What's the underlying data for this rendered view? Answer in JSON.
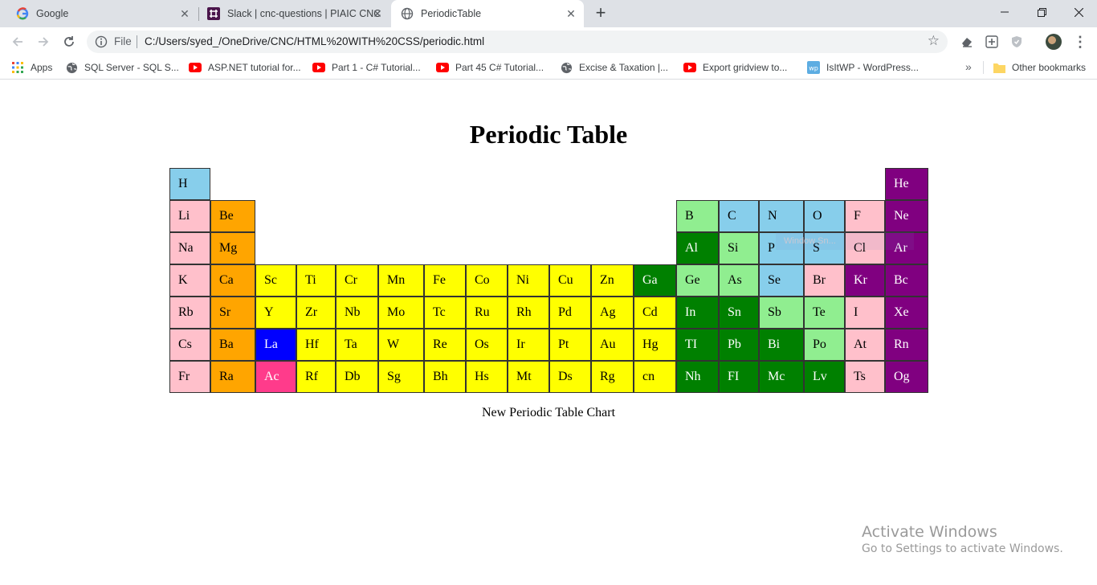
{
  "browser": {
    "tabs": [
      {
        "title": "Google",
        "icon": "google-g-icon"
      },
      {
        "title": "Slack | cnc-questions | PIAIC CNC",
        "icon": "slack-icon"
      },
      {
        "title": "PeriodicTable",
        "icon": "globe-icon"
      }
    ],
    "active_tab": 2,
    "omnibox": {
      "scheme": "File",
      "url": "C:/Users/syed_/OneDrive/CNC/HTML%20WITH%20CSS/periodic.html"
    },
    "bookmarks": [
      {
        "label": "Apps",
        "icon": "apps-grid-icon"
      },
      {
        "label": "SQL Server - SQL S...",
        "icon": "globe-icon"
      },
      {
        "label": "ASP.NET tutorial for...",
        "icon": "youtube-icon"
      },
      {
        "label": "Part 1 - C# Tutorial...",
        "icon": "youtube-icon"
      },
      {
        "label": "Part 45 C# Tutorial...",
        "icon": "youtube-icon"
      },
      {
        "label": "Excise & Taxation |...",
        "icon": "globe-icon"
      },
      {
        "label": "Export gridview to...",
        "icon": "youtube-icon"
      },
      {
        "label": "IsItWP - WordPress...",
        "icon": "wordpress-icon"
      }
    ],
    "bookmarks_more": "»",
    "other_bookmarks": "Other bookmarks"
  },
  "colors": {
    "pink": "#ffc0cb",
    "orange": "#ffa500",
    "yellow": "#ffff00",
    "green": "#008000",
    "lightgreen": "#90ee90",
    "skyblue": "#87ceeb",
    "purple": "#800080",
    "blue": "#0000ff",
    "magenta": "#ff3b8b"
  },
  "page": {
    "title": "Periodic Table",
    "caption": "New Periodic Table Chart",
    "overlay_text": "Window Sn..."
  },
  "elements": [
    {
      "symbol": "H",
      "color": "skyblue"
    },
    {
      "symbol": "He",
      "color": "purple"
    },
    {
      "symbol": "Li",
      "color": "pink"
    },
    {
      "symbol": "Be",
      "color": "orange"
    },
    {
      "symbol": "B",
      "color": "lightgreen"
    },
    {
      "symbol": "C",
      "color": "skyblue"
    },
    {
      "symbol": "N",
      "color": "skyblue"
    },
    {
      "symbol": "O",
      "color": "skyblue"
    },
    {
      "symbol": "F",
      "color": "pink"
    },
    {
      "symbol": "Ne",
      "color": "purple"
    },
    {
      "symbol": "Na",
      "color": "pink"
    },
    {
      "symbol": "Mg",
      "color": "orange"
    },
    {
      "symbol": "Al",
      "color": "green"
    },
    {
      "symbol": "Si",
      "color": "lightgreen"
    },
    {
      "symbol": "P",
      "color": "skyblue"
    },
    {
      "symbol": "S",
      "color": "skyblue"
    },
    {
      "symbol": "Cl",
      "color": "pink"
    },
    {
      "symbol": "Ar",
      "color": "purple"
    },
    {
      "symbol": "K",
      "color": "pink"
    },
    {
      "symbol": "Ca",
      "color": "orange"
    },
    {
      "symbol": "Sc",
      "color": "yellow"
    },
    {
      "symbol": "Ti",
      "color": "yellow"
    },
    {
      "symbol": "Cr",
      "color": "yellow"
    },
    {
      "symbol": "Mn",
      "color": "yellow"
    },
    {
      "symbol": "Fe",
      "color": "yellow"
    },
    {
      "symbol": "Co",
      "color": "yellow"
    },
    {
      "symbol": "Ni",
      "color": "yellow"
    },
    {
      "symbol": "Cu",
      "color": "yellow"
    },
    {
      "symbol": "Zn",
      "color": "yellow"
    },
    {
      "symbol": "Ga",
      "color": "green"
    },
    {
      "symbol": "Ge",
      "color": "lightgreen"
    },
    {
      "symbol": "As",
      "color": "lightgreen"
    },
    {
      "symbol": "Se",
      "color": "skyblue"
    },
    {
      "symbol": "Br",
      "color": "pink"
    },
    {
      "symbol": "Kr",
      "color": "purple"
    },
    {
      "symbol": "Bc",
      "color": "purple"
    },
    {
      "symbol": "Rb",
      "color": "pink"
    },
    {
      "symbol": "Sr",
      "color": "orange"
    },
    {
      "symbol": "Y",
      "color": "yellow"
    },
    {
      "symbol": "Zr",
      "color": "yellow"
    },
    {
      "symbol": "Nb",
      "color": "yellow"
    },
    {
      "symbol": "Mo",
      "color": "yellow"
    },
    {
      "symbol": "Tc",
      "color": "yellow"
    },
    {
      "symbol": "Ru",
      "color": "yellow"
    },
    {
      "symbol": "Rh",
      "color": "yellow"
    },
    {
      "symbol": "Pd",
      "color": "yellow"
    },
    {
      "symbol": "Ag",
      "color": "yellow"
    },
    {
      "symbol": "Cd",
      "color": "yellow"
    },
    {
      "symbol": "In",
      "color": "green"
    },
    {
      "symbol": "Sn",
      "color": "green"
    },
    {
      "symbol": "Sb",
      "color": "lightgreen"
    },
    {
      "symbol": "Te",
      "color": "lightgreen"
    },
    {
      "symbol": "I",
      "color": "pink"
    },
    {
      "symbol": "Xe",
      "color": "purple"
    },
    {
      "symbol": "Cs",
      "color": "pink"
    },
    {
      "symbol": "Ba",
      "color": "orange"
    },
    {
      "symbol": "La",
      "color": "blue"
    },
    {
      "symbol": "Hf",
      "color": "yellow"
    },
    {
      "symbol": "Ta",
      "color": "yellow"
    },
    {
      "symbol": "W",
      "color": "yellow"
    },
    {
      "symbol": "Re",
      "color": "yellow"
    },
    {
      "symbol": "Os",
      "color": "yellow"
    },
    {
      "symbol": "Ir",
      "color": "yellow"
    },
    {
      "symbol": "Pt",
      "color": "yellow"
    },
    {
      "symbol": "Au",
      "color": "yellow"
    },
    {
      "symbol": "Hg",
      "color": "yellow"
    },
    {
      "symbol": "TI",
      "color": "green"
    },
    {
      "symbol": "Pb",
      "color": "green"
    },
    {
      "symbol": "Bi",
      "color": "green"
    },
    {
      "symbol": "Po",
      "color": "lightgreen"
    },
    {
      "symbol": "At",
      "color": "pink"
    },
    {
      "symbol": "Rn",
      "color": "purple"
    },
    {
      "symbol": "Fr",
      "color": "pink"
    },
    {
      "symbol": "Ra",
      "color": "orange"
    },
    {
      "symbol": "Ac",
      "color": "magenta"
    },
    {
      "symbol": "Rf",
      "color": "yellow"
    },
    {
      "symbol": "Db",
      "color": "yellow"
    },
    {
      "symbol": "Sg",
      "color": "yellow"
    },
    {
      "symbol": "Bh",
      "color": "yellow"
    },
    {
      "symbol": "Hs",
      "color": "yellow"
    },
    {
      "symbol": "Mt",
      "color": "yellow"
    },
    {
      "symbol": "Ds",
      "color": "yellow"
    },
    {
      "symbol": "Rg",
      "color": "yellow"
    },
    {
      "symbol": "cn",
      "color": "yellow"
    },
    {
      "symbol": "Nh",
      "color": "green"
    },
    {
      "symbol": "FI",
      "color": "green"
    },
    {
      "symbol": "Mc",
      "color": "green"
    },
    {
      "symbol": "Lv",
      "color": "green"
    },
    {
      "symbol": "Ts",
      "color": "pink"
    },
    {
      "symbol": "Og",
      "color": "purple"
    }
  ],
  "watermark": {
    "line1": "Activate Windows",
    "line2": "Go to Settings to activate Windows."
  }
}
